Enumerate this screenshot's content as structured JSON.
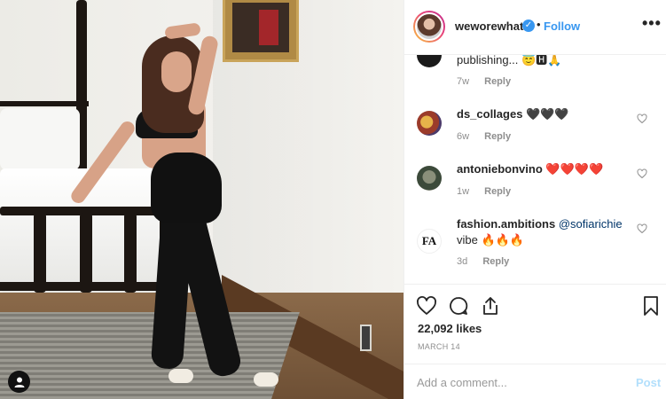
{
  "header": {
    "username": "weworewhat",
    "verified_icon": "✓",
    "separator": "•",
    "follow_label": "Follow",
    "more_icon": "•••"
  },
  "comments": [
    {
      "username": "",
      "text": "publishing... 😇🅷🙏",
      "age": "7w",
      "reply_label": "Reply"
    },
    {
      "username": "ds_collages",
      "text": "🖤🖤🖤",
      "age": "6w",
      "reply_label": "Reply"
    },
    {
      "username": "antoniebonvino",
      "text": "❤️❤️❤️❤️",
      "age": "1w",
      "reply_label": "Reply"
    },
    {
      "username": "fashion.ambitions",
      "mention": "@sofiarichie",
      "text": "vibe 🔥🔥🔥",
      "age": "3d",
      "reply_label": "Reply",
      "avatar_text": "FA"
    }
  ],
  "actions": {
    "likes": "22,092 likes",
    "date": "MARCH 14"
  },
  "add_comment": {
    "placeholder": "Add a comment...",
    "post_label": "Post"
  },
  "colors": {
    "accent": "#3897f0",
    "post_disabled": "#b2dffc",
    "meta": "#8e8e8e"
  }
}
